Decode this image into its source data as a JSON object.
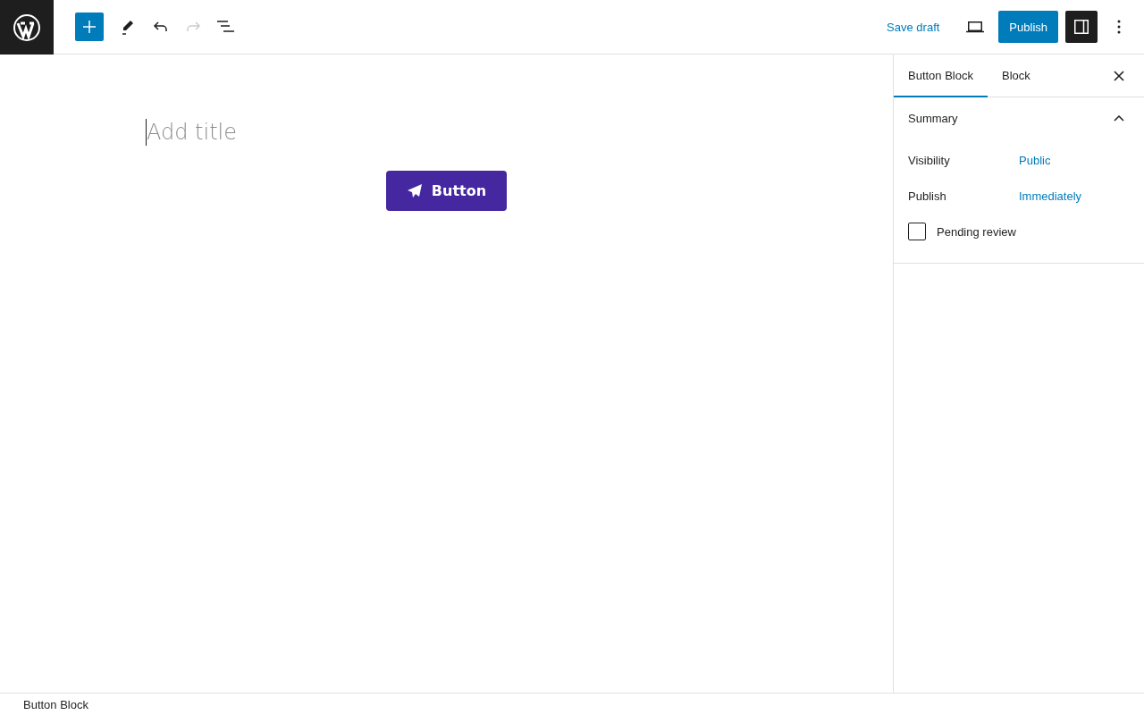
{
  "toolbar": {
    "inserter_open": false,
    "undo_disabled": false,
    "redo_disabled": true,
    "save_draft": "Save draft",
    "publish": "Publish",
    "settings_on": true
  },
  "editor": {
    "title_placeholder": "Add title",
    "button": {
      "label": "Button",
      "color": "#4527a0"
    }
  },
  "sidebar": {
    "tabs": [
      {
        "label": "Button Block",
        "selected": true
      },
      {
        "label": "Block",
        "selected": false
      }
    ],
    "panel": {
      "title": "Summary",
      "expanded": true,
      "rows": [
        {
          "label": "Visibility",
          "value": "Public"
        },
        {
          "label": "Publish",
          "value": "Immediately"
        }
      ],
      "pending_review": {
        "label": "Pending review",
        "checked": false
      }
    }
  },
  "footer": {
    "breadcrumb": "Button Block"
  }
}
